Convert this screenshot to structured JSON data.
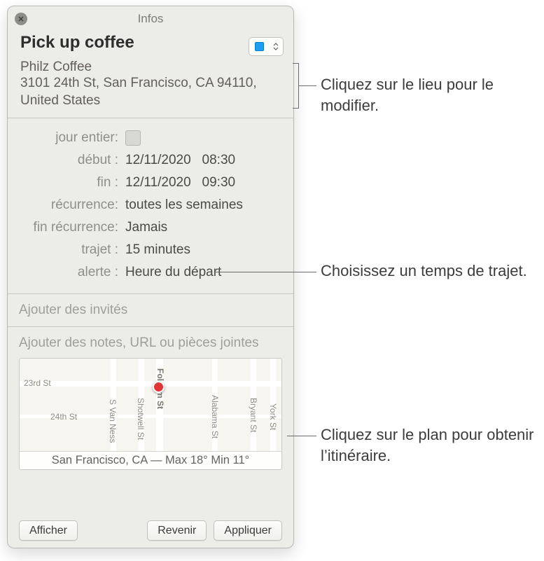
{
  "window": {
    "title": "Infos"
  },
  "event": {
    "title": "Pick up coffee",
    "location_name": "Philz Coffee",
    "location_address": "3101 24th St, San Francisco, CA 94110, United States",
    "calendar_color": "#1e9ef0"
  },
  "labels": {
    "all_day": "jour entier:",
    "start": "début :",
    "end": "fin :",
    "recurrence": "récurrence:",
    "end_recurrence": "fin récurrence:",
    "travel": "trajet :",
    "alert": "alerte :"
  },
  "values": {
    "start_date": "12/11/2020",
    "start_time": "08:30",
    "end_date": "12/11/2020",
    "end_time": "09:30",
    "recurrence": "toutes les semaines",
    "end_recurrence": "Jamais",
    "travel": "15 minutes",
    "alert": "Heure du départ"
  },
  "placeholders": {
    "invites": "Ajouter des invités",
    "notes": "Ajouter des notes, URL ou pièces jointes"
  },
  "map": {
    "weather": "San Francisco, CA — Max 18° Min 11°",
    "street1": "23rd St",
    "street2": "24th St",
    "streetV1": "S Van Ness",
    "streetV2": "Shotwell St",
    "streetV3": "Folsom St",
    "streetV4": "Alabama St",
    "streetV5": "Bryant St",
    "streetV6": "York St"
  },
  "buttons": {
    "show": "Afficher",
    "revert": "Revenir",
    "apply": "Appliquer"
  },
  "callouts": {
    "c1": "Cliquez sur le lieu pour le modifier.",
    "c2": "Choisissez un temps de trajet.",
    "c3": "Cliquez sur le plan pour obtenir l’itinéraire."
  }
}
